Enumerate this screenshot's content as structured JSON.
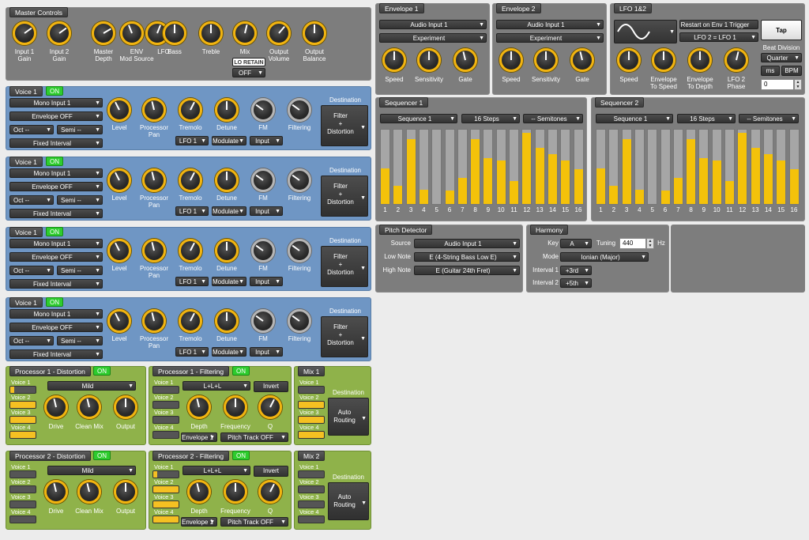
{
  "master": {
    "title": "Master Controls",
    "knobs": [
      {
        "label": "Input 1\nGain",
        "value": 0.7
      },
      {
        "label": "Input 2\nGain",
        "value": 0.7
      },
      {
        "label": "Master\nDepth",
        "value": 0.72
      },
      {
        "label": "ENV\nMod Source",
        "value": 0.42
      },
      {
        "label": "LFO",
        "value": 0.58
      },
      {
        "label": "Bass",
        "value": 0.5
      },
      {
        "label": "Treble",
        "value": 0.5
      },
      {
        "label": "Mix",
        "value": 0.55
      },
      {
        "label": "Output\nVolume",
        "value": 0.65
      },
      {
        "label": "Output\nBalance",
        "value": 0.5
      }
    ],
    "lo_retain": "LO RETAIN",
    "lo_retain_value": "OFF"
  },
  "voices": [
    {
      "title": "Voice 1",
      "on": "ON",
      "input": "Mono Input 1",
      "envelope": "Envelope OFF",
      "oct": "Oct --",
      "semi": "Semi --",
      "interval": "Fixed Interval",
      "knobs": [
        {
          "label": "Level",
          "value": 0.4
        },
        {
          "label": "Processor\nPan",
          "value": 0.45
        },
        {
          "label": "Tremolo",
          "value": 0.6
        },
        {
          "label": "Detune",
          "value": 0.5
        },
        {
          "label": "FM",
          "value": 0.3
        },
        {
          "label": "Filtering",
          "value": 0.3
        }
      ],
      "tremolo_src": "LFO 1",
      "detune_mode": "Modulate",
      "fm_src": "Input",
      "dest_label": "Destination",
      "dest": "Filter\n+\nDistortion"
    },
    {
      "title": "Voice 1",
      "on": "ON",
      "input": "Mono Input 1",
      "envelope": "Envelope OFF",
      "oct": "Oct --",
      "semi": "Semi --",
      "interval": "Fixed Interval",
      "knobs": [
        {
          "label": "Level",
          "value": 0.4
        },
        {
          "label": "Processor\nPan",
          "value": 0.45
        },
        {
          "label": "Tremolo",
          "value": 0.6
        },
        {
          "label": "Detune",
          "value": 0.5
        },
        {
          "label": "FM",
          "value": 0.3
        },
        {
          "label": "Filtering",
          "value": 0.3
        }
      ],
      "tremolo_src": "LFO 1",
      "detune_mode": "Modulate",
      "fm_src": "Input",
      "dest_label": "Destination",
      "dest": "Filter\n+\nDistortion"
    },
    {
      "title": "Voice 1",
      "on": "ON",
      "input": "Mono Input 1",
      "envelope": "Envelope OFF",
      "oct": "Oct --",
      "semi": "Semi --",
      "interval": "Fixed Interval",
      "knobs": [
        {
          "label": "Level",
          "value": 0.4
        },
        {
          "label": "Processor\nPan",
          "value": 0.45
        },
        {
          "label": "Tremolo",
          "value": 0.6
        },
        {
          "label": "Detune",
          "value": 0.5
        },
        {
          "label": "FM",
          "value": 0.3
        },
        {
          "label": "Filtering",
          "value": 0.3
        }
      ],
      "tremolo_src": "LFO 1",
      "detune_mode": "Modulate",
      "fm_src": "Input",
      "dest_label": "Destination",
      "dest": "Filter\n+\nDistortion"
    },
    {
      "title": "Voice 1",
      "on": "ON",
      "input": "Mono Input 1",
      "envelope": "Envelope OFF",
      "oct": "Oct --",
      "semi": "Semi --",
      "interval": "Fixed Interval",
      "knobs": [
        {
          "label": "Level",
          "value": 0.4
        },
        {
          "label": "Processor\nPan",
          "value": 0.45
        },
        {
          "label": "Tremolo",
          "value": 0.6
        },
        {
          "label": "Detune",
          "value": 0.5
        },
        {
          "label": "FM",
          "value": 0.3
        },
        {
          "label": "Filtering",
          "value": 0.3
        }
      ],
      "tremolo_src": "LFO 1",
      "detune_mode": "Modulate",
      "fm_src": "Input",
      "dest_label": "Destination",
      "dest": "Filter\n+\nDistortion"
    }
  ],
  "processors": [
    {
      "dist_title": "Processor 1 - Distortion",
      "dist_on": "ON",
      "dist_mode": "Mild",
      "dist_voices": [
        {
          "label": "Voice 1",
          "level": 0.15
        },
        {
          "label": "Voice 2",
          "level": 1.0
        },
        {
          "label": "Voice 3",
          "level": 1.0
        },
        {
          "label": "Voice 4",
          "level": 1.0
        }
      ],
      "dist_knobs": [
        {
          "label": "Drive",
          "value": 0.45
        },
        {
          "label": "Clean Mix",
          "value": 0.45
        },
        {
          "label": "Output",
          "value": 0.5
        }
      ],
      "filt_title": "Processor 1 - Filtering",
      "filt_on": "ON",
      "filt_mode": "L+L+L",
      "invert": "Invert",
      "filt_voices": [
        {
          "label": "Voice 1",
          "level": 0
        },
        {
          "label": "Voice 2",
          "level": 0
        },
        {
          "label": "Voice 3",
          "level": 0
        },
        {
          "label": "Voice 4",
          "level": 0
        }
      ],
      "filt_knobs": [
        {
          "label": "Depth",
          "value": 0.45
        },
        {
          "label": "Frequency",
          "value": 0.5
        },
        {
          "label": "Q",
          "value": 0.6
        }
      ],
      "depth_src": "Envelope 1",
      "pitch_track": "Pitch Track OFF",
      "mix_title": "Mix 1",
      "mix_voices": [
        {
          "label": "Voice 1",
          "level": 0
        },
        {
          "label": "Voice 2",
          "level": 1.0
        },
        {
          "label": "Voice 3",
          "level": 1.0
        },
        {
          "label": "Voice 4",
          "level": 1.0
        }
      ],
      "mix_dest_label": "Destination",
      "mix_dest": "Auto\nRouting"
    },
    {
      "dist_title": "Processor 2 - Distortion",
      "dist_on": "ON",
      "dist_mode": "Mild",
      "dist_voices": [
        {
          "label": "Voice 1",
          "level": 0
        },
        {
          "label": "Voice 2",
          "level": 0
        },
        {
          "label": "Voice 3",
          "level": 0
        },
        {
          "label": "Voice 4",
          "level": 0
        }
      ],
      "dist_knobs": [
        {
          "label": "Drive",
          "value": 0.45
        },
        {
          "label": "Clean Mix",
          "value": 0.45
        },
        {
          "label": "Output",
          "value": 0.5
        }
      ],
      "filt_title": "Processor 2 - Filtering",
      "filt_on": "ON",
      "filt_mode": "L+L+L",
      "invert": "Invert",
      "filt_voices": [
        {
          "label": "Voice 1",
          "level": 0.15
        },
        {
          "label": "Voice 2",
          "level": 1.0
        },
        {
          "label": "Voice 3",
          "level": 1.0
        },
        {
          "label": "Voice 4",
          "level": 1.0
        }
      ],
      "filt_knobs": [
        {
          "label": "Depth",
          "value": 0.45
        },
        {
          "label": "Frequency",
          "value": 0.5
        },
        {
          "label": "Q",
          "value": 0.6
        }
      ],
      "depth_src": "Envelope 1",
      "pitch_track": "Pitch Track OFF",
      "mix_title": "Mix 2",
      "mix_voices": [
        {
          "label": "Voice 1",
          "level": 0
        },
        {
          "label": "Voice 2",
          "level": 0
        },
        {
          "label": "Voice 3",
          "level": 0
        },
        {
          "label": "Voice 4",
          "level": 0
        }
      ],
      "mix_dest_label": "Destination",
      "mix_dest": "Auto\nRouting"
    }
  ],
  "envelopes": [
    {
      "title": "Envelope 1",
      "source": "Audio Input 1",
      "mode": "Experiment",
      "knobs": [
        {
          "label": "Speed",
          "value": 0.5
        },
        {
          "label": "Sensitivity",
          "value": 0.5
        },
        {
          "label": "Gate",
          "value": 0.45
        }
      ]
    },
    {
      "title": "Envelope 2",
      "source": "Audio Input 1",
      "mode": "Experiment",
      "knobs": [
        {
          "label": "Speed",
          "value": 0.5
        },
        {
          "label": "Sensitivity",
          "value": 0.5
        },
        {
          "label": "Gate",
          "value": 0.45
        }
      ]
    }
  ],
  "lfo": {
    "title": "LFO 1&2",
    "waveform_icon": "sine-wave-icon",
    "restart": "Restart on Env 1 Trigger",
    "lfo2": "LFO 2 = LFO 1",
    "tap": "Tap",
    "beat_division_label": "Beat Division",
    "beat_division": "Quarter",
    "ms": "ms",
    "bpm": "BPM",
    "value": "0",
    "knobs": [
      {
        "label": "Speed",
        "value": 0.5
      },
      {
        "label": "Envelope\nTo Speed",
        "value": 0.5
      },
      {
        "label": "Envelope\nTo Depth",
        "value": 0.5
      },
      {
        "label": "LFO 2\nPhase",
        "value": 0.55
      }
    ]
  },
  "sequencers": [
    {
      "title": "Sequencer 1",
      "pattern": "Sequence 1",
      "steps": "16 Steps",
      "semis": "-- Semitones",
      "values": [
        0.48,
        0.24,
        0.87,
        0.19,
        0.0,
        0.18,
        0.35,
        0.87,
        0.62,
        0.59,
        0.31,
        0.96,
        0.76,
        0.67,
        0.58,
        0.47
      ]
    },
    {
      "title": "Sequencer 2",
      "pattern": "Sequence 1",
      "steps": "16 Steps",
      "semis": "-- Semitones",
      "values": [
        0.48,
        0.24,
        0.87,
        0.19,
        0.0,
        0.18,
        0.35,
        0.87,
        0.62,
        0.59,
        0.31,
        0.96,
        0.76,
        0.67,
        0.58,
        0.47
      ]
    }
  ],
  "pitch": {
    "title": "Pitch Detector",
    "source_label": "Source",
    "source": "Audio Input 1",
    "low_label": "Low Note",
    "low": "E (4-String Bass Low E)",
    "high_label": "High Note",
    "high": "E (Guitar 24th Fret)"
  },
  "harmony": {
    "title": "Harmony",
    "key_label": "Key",
    "key": "A",
    "tuning_label": "Tuning",
    "tuning": "440",
    "hz": "Hz",
    "mode_label": "Mode",
    "mode": "Ionian (Major)",
    "i1_label": "Interval 1",
    "i1": "+3rd",
    "i2_label": "Interval 2",
    "i2": "+5th"
  }
}
